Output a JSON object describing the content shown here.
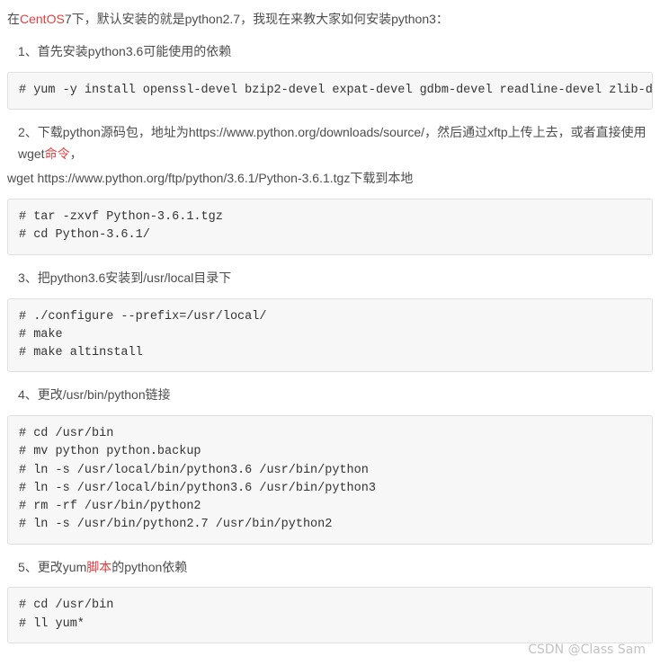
{
  "intro": {
    "prefix": "在",
    "highlight": "CentOS",
    "suffix": "7下，默认安装的就是python2.7，我现在来教大家如何安装python3："
  },
  "steps": {
    "s1": {
      "text": "1、首先安装python3.6可能使用的依赖",
      "code": "# yum -y install openssl-devel bzip2-devel expat-devel gdbm-devel readline-devel zlib-devel"
    },
    "s2": {
      "line_part1": "2、下载python源码包，地址为https://www.python.org/downloads/source/，然后通过xftp上传上去，或者直接使用wget",
      "line_highlight": "命令",
      "line_part2": "，",
      "cont": "wget https://www.python.org/ftp/python/3.6.1/Python-3.6.1.tgz下载到本地",
      "code": "# tar -zxvf Python-3.6.1.tgz\n# cd Python-3.6.1/"
    },
    "s3": {
      "text": "3、把python3.6安装到/usr/local目录下",
      "code": "# ./configure --prefix=/usr/local/\n# make\n# make altinstall"
    },
    "s4": {
      "text": "4、更改/usr/bin/python链接",
      "code": "# cd /usr/bin\n# mv python python.backup\n# ln -s /usr/local/bin/python3.6 /usr/bin/python\n# ln -s /usr/local/bin/python3.6 /usr/bin/python3\n# rm -rf /usr/bin/python2\n# ln -s /usr/bin/python2.7 /usr/bin/python2"
    },
    "s5": {
      "prefix": "5、更改yum",
      "highlight": "脚本",
      "suffix": "的python依赖",
      "code": "# cd /usr/bin\n# ll yum*"
    }
  },
  "watermark": "CSDN @Class Sam"
}
